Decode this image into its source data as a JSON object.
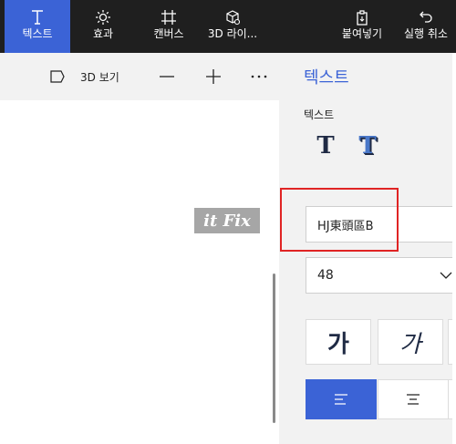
{
  "toolbar": {
    "items": [
      {
        "label": "텍스트",
        "icon": "text-icon",
        "active": true
      },
      {
        "label": "효과",
        "icon": "sun-icon"
      },
      {
        "label": "캔버스",
        "icon": "canvas-icon"
      },
      {
        "label": "3D 라이...",
        "icon": "3d-library-icon"
      },
      {
        "label": "붙여넣기",
        "icon": "paste-icon"
      },
      {
        "label": "실행 취소",
        "icon": "undo-icon"
      }
    ]
  },
  "subbar": {
    "view3d_label": "3D 보기",
    "panel_title": "텍스트"
  },
  "canvas": {
    "watermark_text": "it Fix"
  },
  "panel": {
    "section_label": "텍스트",
    "text_type_2d": "T",
    "text_type_3d": "T",
    "font_value": "HJ東頭區B",
    "size_value": "48",
    "bold_label": "가",
    "italic_label": "가"
  },
  "colors": {
    "accent": "#3b63d6",
    "toolbar_bg": "#1f1f1f",
    "panel_bg": "#f2f2f2",
    "highlight": "#e02424"
  }
}
